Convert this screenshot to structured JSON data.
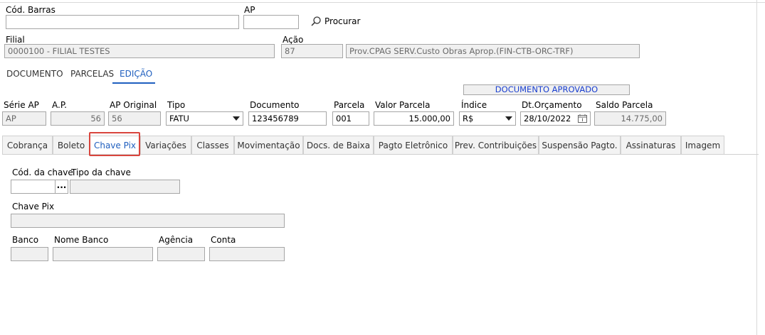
{
  "search": {
    "barcode_label": "Cód. Barras",
    "barcode_value": "",
    "ap_label": "AP",
    "ap_value": "",
    "search_label": "Procurar"
  },
  "header": {
    "filial_label": "Filial",
    "filial_value": "0000100 - FILIAL TESTES",
    "acao_label": "Ação",
    "acao_code": "87",
    "acao_desc": "Prov.CPAG SERV.Custo Obras Aprop.(FIN-CTB-ORC-TRF)"
  },
  "top_tabs": [
    {
      "label": "DOCUMENTO",
      "active": false
    },
    {
      "label": "PARCELAS",
      "active": false
    },
    {
      "label": "EDIÇÃO",
      "active": true
    }
  ],
  "status": "DOCUMENTO APROVADO",
  "fields": {
    "serie_ap": {
      "label": "Série AP",
      "value": "AP"
    },
    "ap_num": {
      "label": "A.P.",
      "value": "56"
    },
    "ap_original": {
      "label": "AP Original",
      "value": "56"
    },
    "tipo": {
      "label": "Tipo",
      "value": "FATU"
    },
    "documento": {
      "label": "Documento",
      "value": "123456789"
    },
    "parcela": {
      "label": "Parcela",
      "value": "001"
    },
    "valor_parcela": {
      "label": "Valor Parcela",
      "value": "15.000,00"
    },
    "indice": {
      "label": "Índice",
      "value": "R$"
    },
    "dt_orcamento": {
      "label": "Dt.Orçamento",
      "value": "28/10/2022"
    },
    "saldo_parcela": {
      "label": "Saldo Parcela",
      "value": "14.775,00"
    }
  },
  "sub_tabs": [
    {
      "label": "Cobrança"
    },
    {
      "label": "Boleto"
    },
    {
      "label": "Chave Pix"
    },
    {
      "label": "Variações"
    },
    {
      "label": "Classes"
    },
    {
      "label": "Movimentação"
    },
    {
      "label": "Docs. de Baixa"
    },
    {
      "label": "Pagto Eletrônico"
    },
    {
      "label": "Prev. Contribuições"
    },
    {
      "label": "Suspensão Pagto."
    },
    {
      "label": "Assinaturas"
    },
    {
      "label": "Imagem"
    }
  ],
  "active_sub_tab": "Chave Pix",
  "pix": {
    "cod_chave_label": "Cód. da chave",
    "cod_chave_value": "",
    "dots_label": "...",
    "tipo_chave_label": "Tipo da chave",
    "tipo_chave_value": "",
    "chave_pix_label": "Chave Pix",
    "chave_pix_value": "",
    "banco_label": "Banco",
    "banco_value": "",
    "nome_banco_label": "Nome Banco",
    "nome_banco_value": "",
    "agencia_label": "Agência",
    "agencia_value": "",
    "conta_label": "Conta",
    "conta_value": ""
  },
  "colors": {
    "accent": "#1f5fbf",
    "highlight": "#d9453d",
    "status_text": "#1a3fcf"
  }
}
